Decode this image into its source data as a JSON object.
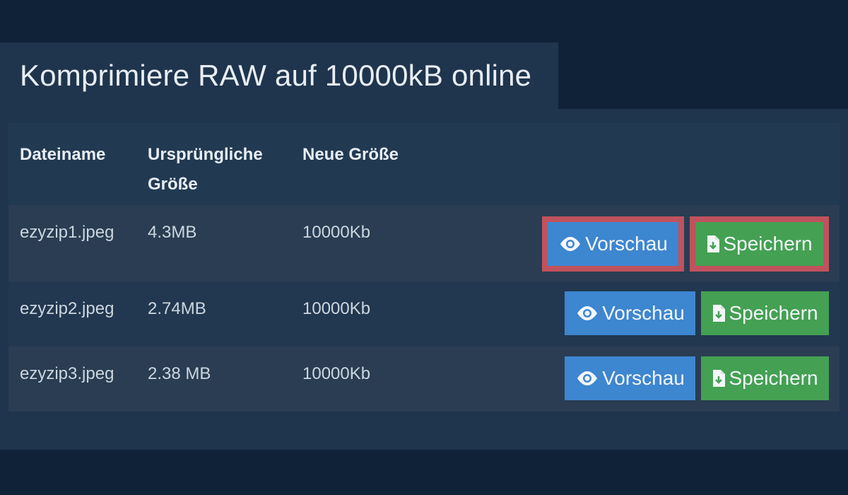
{
  "title": "Komprimiere RAW auf 10000kB online",
  "table": {
    "headers": {
      "filename": "Dateiname",
      "original_size_line1": "Ursprüngliche",
      "original_size_line2": "Größe",
      "new_size": "Neue Größe"
    },
    "rows": [
      {
        "filename": "ezyzip1.jpeg",
        "original_size": "4.3MB",
        "new_size": "10000Kb",
        "preview_label": "Vorschau",
        "save_label": "Speichern"
      },
      {
        "filename": "ezyzip2.jpeg",
        "original_size": "2.74MB",
        "new_size": "10000Kb",
        "preview_label": "Vorschau",
        "save_label": "Speichern"
      },
      {
        "filename": "ezyzip3.jpeg",
        "original_size": "2.38 MB",
        "new_size": "10000Kb",
        "preview_label": "Vorschau",
        "save_label": "Speichern"
      }
    ]
  },
  "icons": {
    "preview": "eye-icon",
    "save": "file-download-icon"
  },
  "colors": {
    "background": "#0f2238",
    "panel": "#1f354d",
    "preview_button": "#3d86d0",
    "save_button": "#44a053",
    "highlight_border": "#c0525d"
  }
}
